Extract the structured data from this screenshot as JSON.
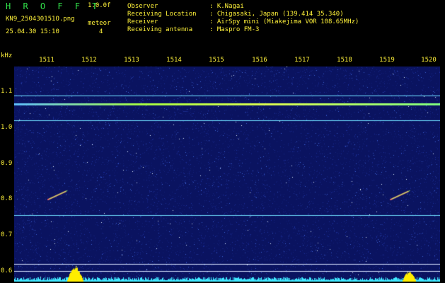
{
  "header": {
    "title": "H R O F F T",
    "version": "1.0.0f",
    "filename": "KN9_250430151O.png",
    "mode": "meteor",
    "datetime": "25.04.30 15:10",
    "count": "4",
    "meta": [
      {
        "label": "Observer",
        "value": ": K.Nagai"
      },
      {
        "label": "Receiving Location",
        "value": ": Chigasaki, Japan (139.414 35.340)"
      },
      {
        "label": "Receiver",
        "value": ": AirSpy mini (Miakejima VOR 108.65MHz)"
      },
      {
        "label": "Receiving antenna",
        "value": ": Maspro FM-3"
      }
    ]
  },
  "axis": {
    "unit": "kHz",
    "minutes": [
      "1511",
      "1512",
      "1513",
      "1514",
      "1515",
      "1516",
      "1517",
      "1518",
      "1519",
      "1520"
    ],
    "y_ticks": [
      "1.1",
      "1.0",
      "0.9",
      "0.8",
      "0.7",
      "0.6"
    ],
    "y_range_khz": [
      0.57,
      1.17
    ]
  },
  "chart_data": {
    "type": "heatmap",
    "x_minutes": [
      "1511",
      "1512",
      "1513",
      "1514",
      "1515",
      "1516",
      "1517",
      "1518",
      "1519",
      "1520"
    ],
    "ylabel": "kHz",
    "y_range_khz": [
      0.57,
      1.17
    ],
    "carrier_lines_khz": [
      1.09,
      1.065,
      1.02,
      0.755,
      0.62,
      0.6
    ],
    "meteor_echoes": [
      {
        "minute_pos": 1511.7,
        "freq_khz": 0.81
      },
      {
        "minute_pos": 1519.3,
        "freq_khz": 0.81
      }
    ],
    "colors": {
      "background": "#0a1360",
      "carrier": "#6fe0ff",
      "main_carrier": "#a8ff40",
      "spectrum": "#40e8ff",
      "peak": "#ffee00"
    }
  }
}
